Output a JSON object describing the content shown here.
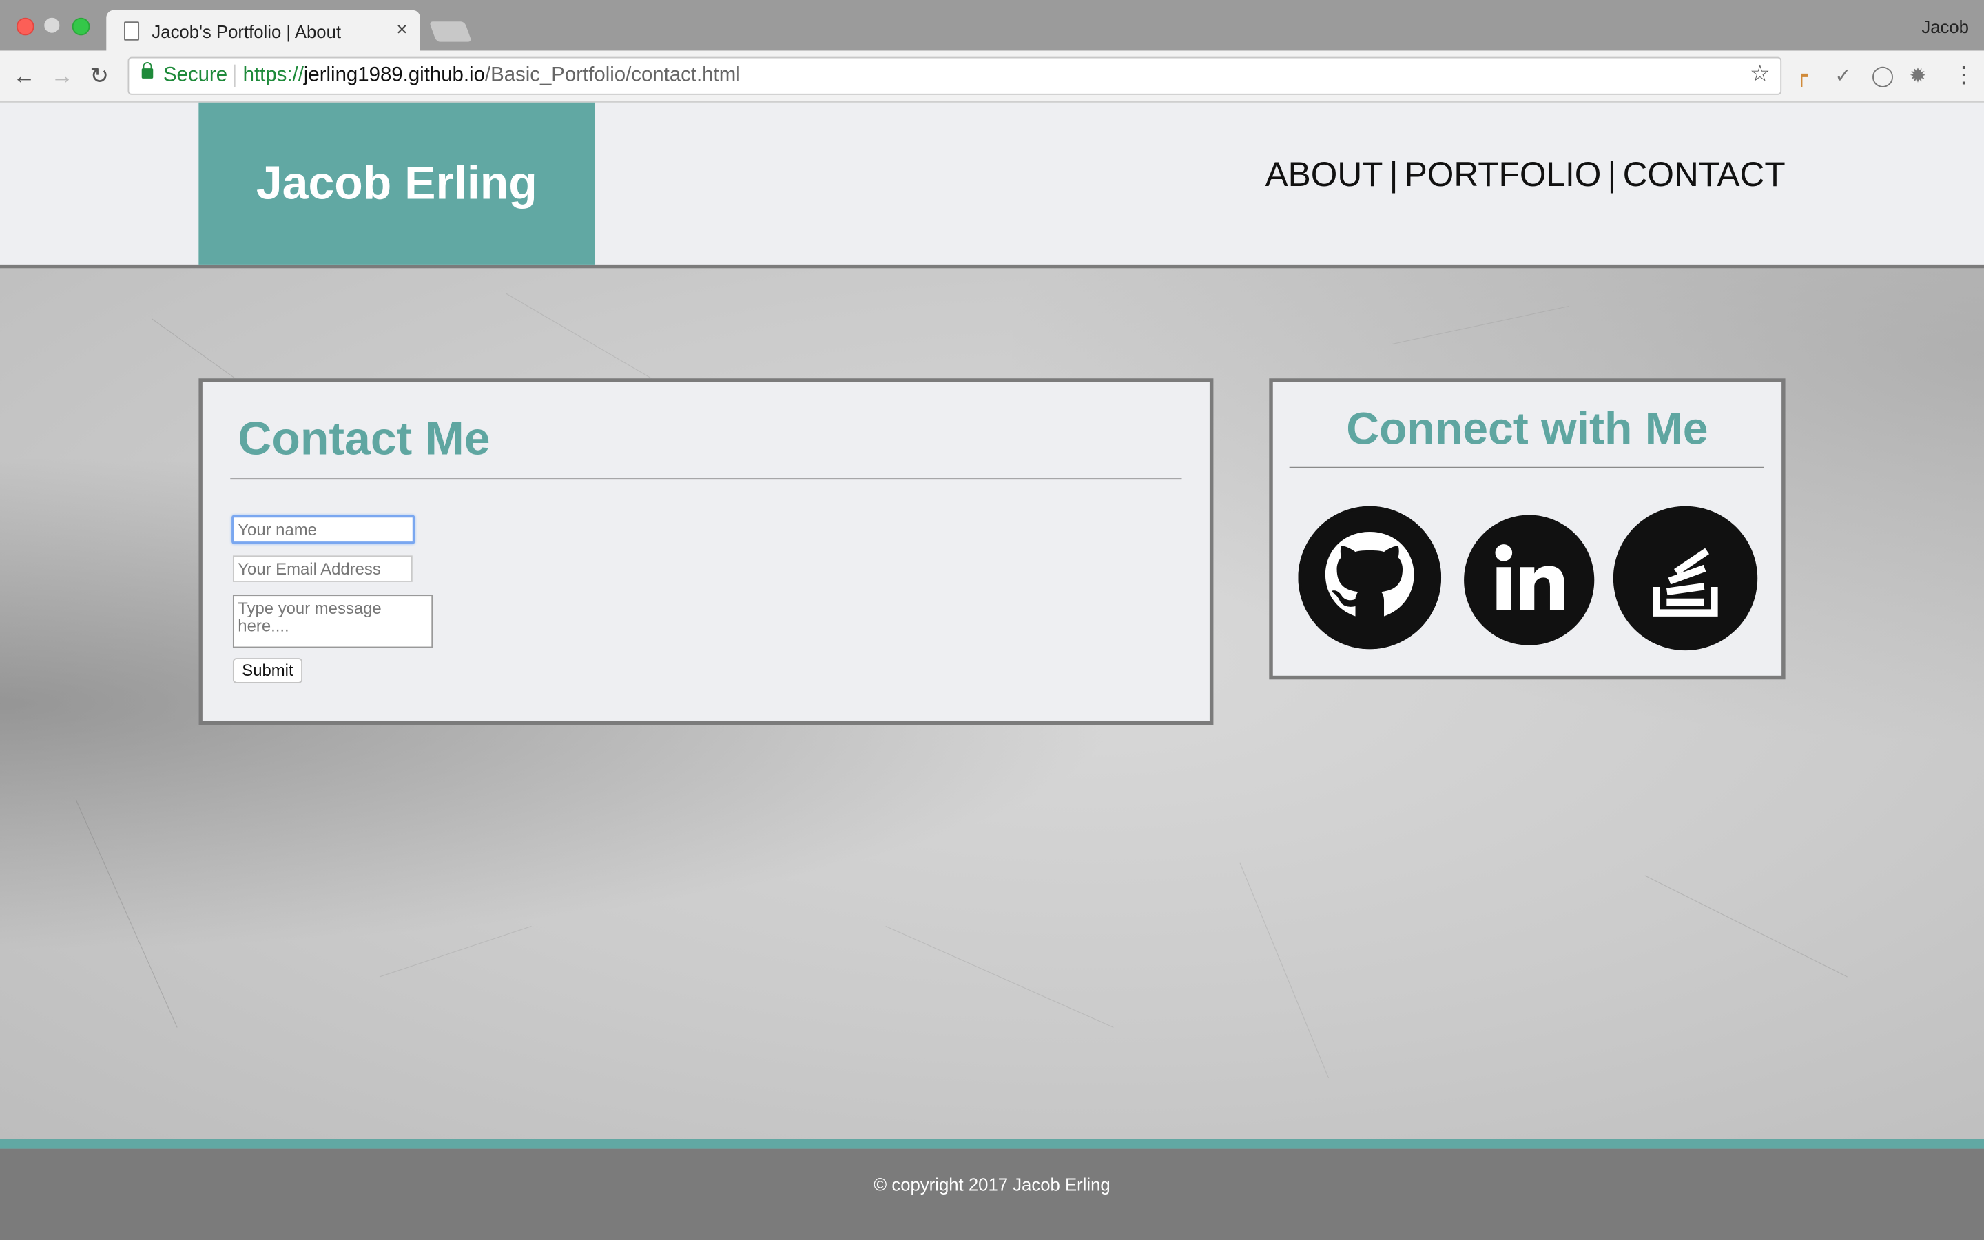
{
  "browser": {
    "tab_title": "Jacob's Portfolio | About",
    "tab_close": "×",
    "profile_name": "Jacob",
    "secure_label": "Secure",
    "url_scheme": "https://",
    "url_host": "jerling1989.github.io",
    "url_path": "/Basic_Portfolio/contact.html"
  },
  "header": {
    "brand": "Jacob Erling",
    "nav": [
      {
        "label": "ABOUT"
      },
      {
        "label": "PORTFOLIO"
      },
      {
        "label": "CONTACT"
      }
    ],
    "divider": "|"
  },
  "contact": {
    "title": "Contact Me",
    "name_placeholder": "Your name",
    "email_placeholder": "Your Email Address",
    "message_placeholder": "Type your message here....",
    "submit_label": "Submit"
  },
  "connect": {
    "title": "Connect with Me",
    "links": [
      {
        "icon": "github-icon"
      },
      {
        "icon": "linkedin-icon"
      },
      {
        "icon": "stackoverflow-icon"
      }
    ]
  },
  "footer": {
    "copyright": "© copyright 2017 Jacob Erling"
  },
  "colors": {
    "accent": "#61a8a3",
    "heading": "#5fa6a1",
    "panel_bg": "#eeeff2",
    "border": "#7b7b7b"
  }
}
